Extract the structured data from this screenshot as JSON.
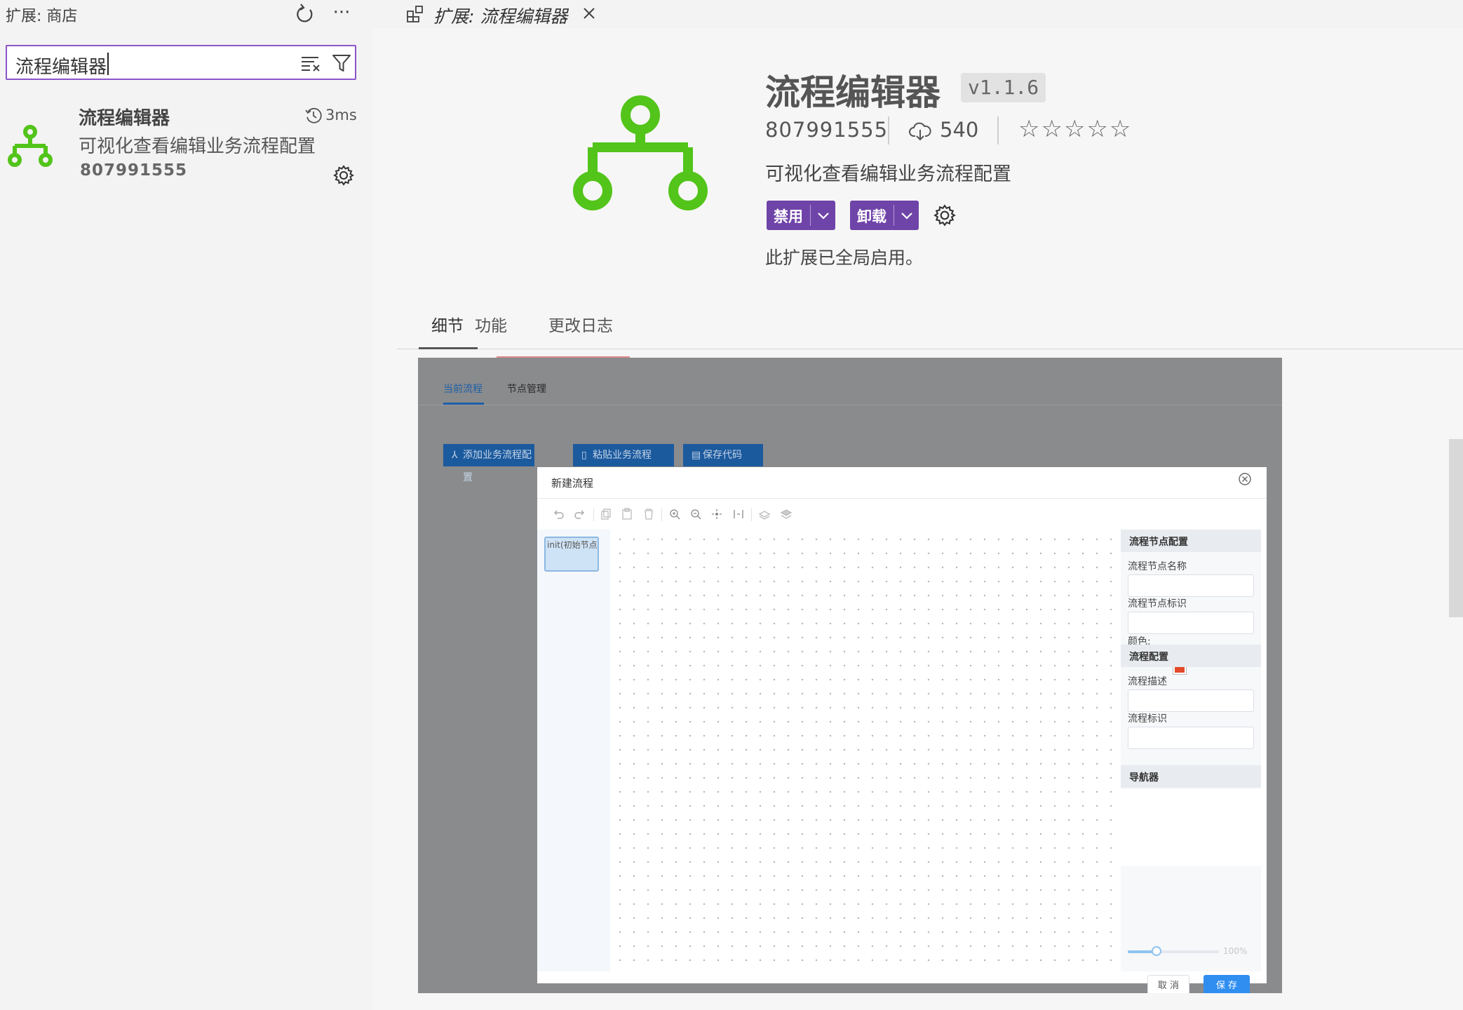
{
  "sidebar": {
    "title": "扩展: 商店",
    "more_label": "···",
    "search": {
      "value": "流程编辑器",
      "placeholder": ""
    },
    "results": [
      {
        "name": "流程编辑器",
        "time": "3ms",
        "description": "可视化查看编辑业务流程配置",
        "publisher": "807991555"
      }
    ]
  },
  "editor": {
    "tab_label": "扩展: 流程编辑器",
    "extension": {
      "name": "流程编辑器",
      "version": "v1.1.6",
      "publisher": "807991555",
      "installs": "540",
      "rating_stars": "☆☆☆☆☆",
      "description": "可视化查看编辑业务流程配置",
      "disable_label": "禁用",
      "uninstall_label": "卸载",
      "status": "此扩展已全局启用。",
      "logo_color": "#52c41a"
    },
    "detail_tabs": [
      "细节",
      "功能",
      "更改日志"
    ],
    "active_detail_tab": "细节"
  },
  "readme_screenshot": {
    "tabs": [
      "当前流程",
      "节点管理"
    ],
    "buttons": [
      "添加业务流程配置",
      "粘贴业务流程",
      "保存代码"
    ],
    "dialog": {
      "title": "新建流程",
      "init_node": "init(初始节点)",
      "panel": {
        "node_section": "流程节点配置",
        "node_name_label": "流程节点名称",
        "node_id_label": "流程节点标识",
        "color_label": "颜色:",
        "color_value": "#e24a2a",
        "flow_section": "流程配置",
        "flow_desc_label": "流程描述",
        "flow_id_label": "流程标识",
        "navigator_section": "导航器",
        "zoom": "100%"
      },
      "cancel_label": "取 消",
      "save_label": "保 存"
    }
  },
  "colors": {
    "accent_purple": "#6f44a8",
    "search_focus": "#8a55c9",
    "primary_blue": "#2f8ef0"
  }
}
